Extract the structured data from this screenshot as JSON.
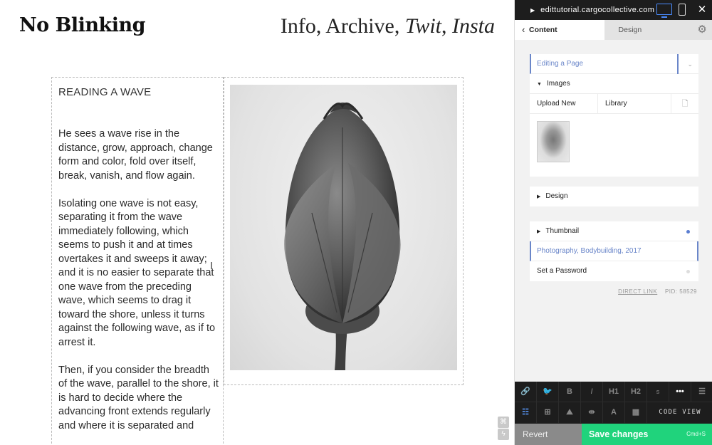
{
  "site": {
    "title": "No Blinking",
    "nav": {
      "info": "Info",
      "archive": "Archive",
      "twit": "Twit",
      "insta": "Insta"
    },
    "heading": "READING A WAVE",
    "paragraphs": [
      "He sees a wave rise in the distance, grow, approach, change form and color, fold over itself, break, vanish, and flow again.",
      "Isolating one wave is not easy, separating it from the wave immediately following, which seems to push it and at times overtakes it and sweeps it away; and it is no easier to separate that one wave from the preceding wave, which seems to drag it toward the shore, unless it turns against the following wave, as if to arrest it.",
      "Then, if you consider the breadth of the wave, parallel to the shore, it is hard to decide where the advancing front extends regularly and where it is separated and"
    ],
    "photo_alt": "Black and white photograph of a flower bud"
  },
  "panel": {
    "url": "edittutorial.cargocollective.com",
    "tabs": {
      "content": "Content",
      "design": "Design"
    },
    "page_select": "Editing a Page",
    "images_section": "Images",
    "upload_new": "Upload New",
    "library": "Library",
    "design_section": "Design",
    "thumbnail_section": "Thumbnail",
    "tags_value": "Photography, Bodybuilding, 2017",
    "password": "Set a Password",
    "direct_link": "DIRECT LINK",
    "pid": "PID: 58529"
  },
  "toolbar": {
    "row1": [
      "link-icon",
      "twitter-icon",
      "B",
      "I",
      "H1",
      "H2",
      "s",
      "more-icon",
      "align-left-icon"
    ],
    "code_view": "CODE VIEW"
  },
  "actions": {
    "revert": "Revert",
    "save": "Save changes",
    "save_shortcut": "Cmd+S"
  },
  "colors": {
    "accent_blue": "#6a86c9",
    "save_green": "#20d37c",
    "toolbar_dark": "#1d1d1d"
  }
}
